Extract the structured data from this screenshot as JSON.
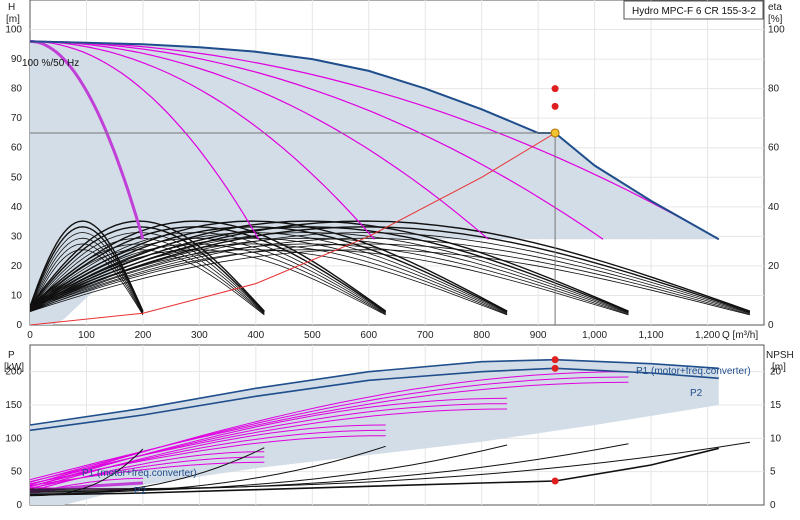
{
  "title": "Hydro MPC-F 6 CR 155-3-2",
  "speed_label": "100 %/50 Hz",
  "colors": {
    "envelope_fill": "#d3dde7",
    "main_curve": "#1f4e8c",
    "speed_curve": "#e000e0",
    "single_pump": "#c040d8",
    "efficiency": "#111111",
    "system_curve": "#e83030",
    "duty_point": "#f4c430",
    "marker": "#e02020",
    "grid": "#e6e6e6",
    "crosshair": "#777777"
  },
  "chart_data": [
    {
      "type": "line",
      "axes": {
        "x": {
          "label": "Q [m³/h]",
          "ticks": [
            "0",
            "100",
            "200",
            "300",
            "400",
            "500",
            "600",
            "700",
            "800",
            "900",
            "1,000",
            "1,100",
            "1,200"
          ],
          "range": [
            0,
            1300
          ]
        },
        "y_left": {
          "label": [
            "H",
            "[m]"
          ],
          "ticks": [
            "0",
            "10",
            "20",
            "30",
            "40",
            "50",
            "60",
            "70",
            "80",
            "90",
            "100"
          ],
          "range": [
            0,
            110
          ]
        },
        "y_right": {
          "label": [
            "eta",
            "[%]"
          ],
          "ticks": [
            "0",
            "20",
            "40",
            "60",
            "80",
            "100"
          ],
          "range": [
            0,
            110
          ]
        }
      },
      "grid": true,
      "duty_point": {
        "q": 930,
        "h": 65
      },
      "efficiency_markers": [
        {
          "q": 930,
          "eta": 80
        },
        {
          "q": 930,
          "eta": 74
        }
      ],
      "head_curves": [
        {
          "pumps": 1,
          "q_max": 200,
          "h0": 96
        },
        {
          "pumps": 2,
          "q_max": 405,
          "h0": 96
        },
        {
          "pumps": 3,
          "q_max": 610,
          "h0": 96
        },
        {
          "pumps": 4,
          "q_max": 812,
          "h0": 96
        },
        {
          "pumps": 5,
          "q_max": 1015,
          "h0": 96
        },
        {
          "pumps": 6,
          "q_max": 1220,
          "h0": 96
        }
      ],
      "main_curve": [
        [
          0,
          96
        ],
        [
          100,
          95.5
        ],
        [
          200,
          95
        ],
        [
          300,
          94
        ],
        [
          400,
          92.5
        ],
        [
          500,
          90
        ],
        [
          600,
          86
        ],
        [
          700,
          80
        ],
        [
          800,
          73
        ],
        [
          900,
          65
        ],
        [
          930,
          65
        ],
        [
          1000,
          54
        ],
        [
          1100,
          42
        ],
        [
          1220,
          29
        ]
      ],
      "system_curve": [
        [
          0,
          0
        ],
        [
          200,
          4
        ],
        [
          400,
          14
        ],
        [
          600,
          30
        ],
        [
          800,
          50
        ],
        [
          930,
          65
        ]
      ]
    },
    {
      "type": "line",
      "axes": {
        "x": {
          "range": [
            0,
            1300
          ]
        },
        "y_left": {
          "label": [
            "P",
            "[kW]"
          ],
          "ticks": [
            "0",
            "50",
            "100",
            "150",
            "200"
          ],
          "range": [
            0,
            240
          ]
        },
        "y_right": {
          "label": [
            "NPSH",
            "[m]"
          ],
          "ticks": [
            "0",
            "5",
            "10",
            "15",
            "20"
          ],
          "range": [
            0,
            24
          ]
        }
      },
      "series_labels": [
        "P1 (motor+freq.converter)",
        "P2",
        "P1 (motor+freq.converter)",
        "P2"
      ],
      "p1_main": [
        [
          0,
          120
        ],
        [
          200,
          145
        ],
        [
          400,
          175
        ],
        [
          600,
          200
        ],
        [
          800,
          215
        ],
        [
          930,
          218
        ],
        [
          1100,
          212
        ],
        [
          1220,
          205
        ]
      ],
      "p2_main": [
        [
          0,
          112
        ],
        [
          200,
          135
        ],
        [
          400,
          163
        ],
        [
          600,
          187
        ],
        [
          800,
          200
        ],
        [
          930,
          205
        ],
        [
          1100,
          198
        ],
        [
          1220,
          190
        ]
      ],
      "markers": [
        {
          "q": 930,
          "p": 218
        },
        {
          "q": 930,
          "p": 205
        },
        {
          "q": 930,
          "npsh": 3.6
        }
      ],
      "npsh_main": [
        [
          0,
          1.5
        ],
        [
          200,
          1.8
        ],
        [
          400,
          2.3
        ],
        [
          600,
          2.8
        ],
        [
          800,
          3.3
        ],
        [
          930,
          3.6
        ],
        [
          1100,
          6
        ],
        [
          1220,
          8.5
        ]
      ]
    }
  ]
}
